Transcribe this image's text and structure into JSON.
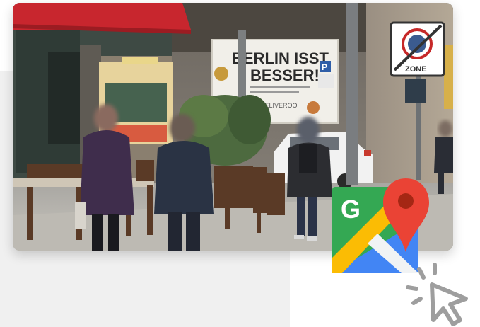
{
  "photo": {
    "poster_line1": "BERLIN ISST",
    "poster_line2": "BESSER!",
    "poster_brand": "DELIVEROO",
    "sign_text": "ZONE",
    "parking_sign": "P"
  },
  "maps_logo": {
    "letter": "G"
  },
  "colors": {
    "maps_green": "#34a853",
    "maps_yellow": "#fbbc04",
    "maps_blue": "#4285f4",
    "maps_red": "#ea4335",
    "cursor": "#9e9e9e"
  },
  "icons": {
    "maps": "google-maps-icon",
    "cursor": "click-cursor-icon"
  }
}
